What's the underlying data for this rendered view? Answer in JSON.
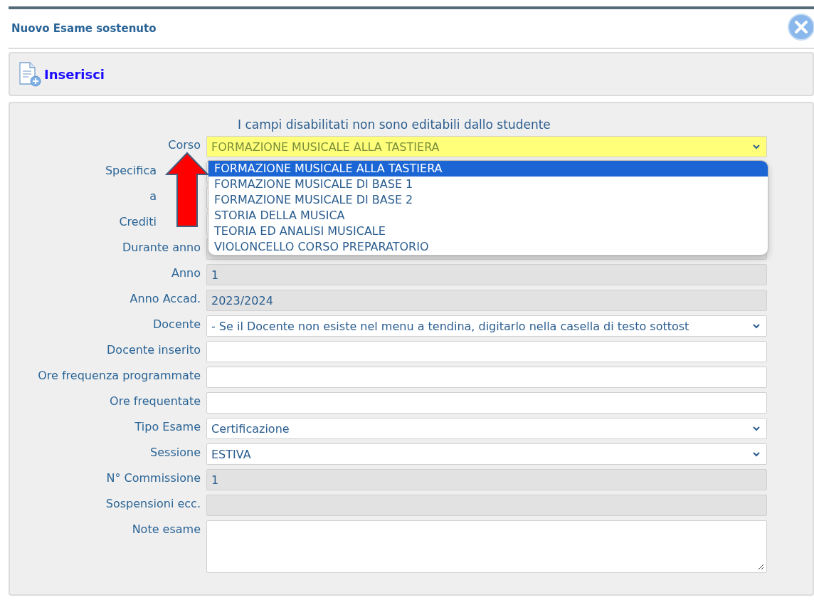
{
  "window": {
    "title": "Nuovo Esame sostenuto"
  },
  "toolbar": {
    "label": "Inserisci"
  },
  "notice": "I campi disabilitati non sono editabili dallo studente",
  "fields": [
    {
      "label": "Corso",
      "kind": "select",
      "value": "FORMAZIONE MUSICALE ALLA TASTIERA",
      "disabled": false,
      "highlighted": true
    },
    {
      "label": "Specifica",
      "kind": "text",
      "disabled": false,
      "highlighted": false
    },
    {
      "label": "a",
      "kind": "text",
      "disabled": false,
      "highlighted": false
    },
    {
      "label": "Crediti",
      "kind": "text",
      "disabled": false,
      "highlighted": false
    },
    {
      "label": "Durante anno",
      "kind": "text",
      "disabled": true,
      "highlighted": false
    },
    {
      "label": "Anno",
      "kind": "text",
      "value": "1",
      "disabled": true,
      "highlighted": false
    },
    {
      "label": "Anno Accad.",
      "kind": "text",
      "value": "2023/2024",
      "disabled": true,
      "highlighted": false
    },
    {
      "label": "Docente",
      "kind": "select",
      "value": "- Se il Docente non esiste nel menu a tendina, digitarlo nella casella di testo sottost",
      "disabled": false,
      "highlighted": false
    },
    {
      "label": "Docente inserito",
      "kind": "text",
      "disabled": false,
      "highlighted": false
    },
    {
      "label": "Ore frequenza programmate",
      "kind": "text",
      "disabled": false,
      "highlighted": false
    },
    {
      "label": "Ore frequentate",
      "kind": "text",
      "disabled": false,
      "highlighted": false
    },
    {
      "label": "Tipo Esame",
      "kind": "select",
      "value": "Certificazione",
      "disabled": false,
      "highlighted": false
    },
    {
      "label": "Sessione",
      "kind": "select",
      "value": "ESTIVA",
      "disabled": false,
      "highlighted": false
    },
    {
      "label": "N° Commissione",
      "kind": "text",
      "value": "1",
      "disabled": true,
      "highlighted": false
    },
    {
      "label": "Sospensioni ecc.",
      "kind": "text",
      "disabled": true,
      "highlighted": false
    },
    {
      "label": "Note esame",
      "kind": "textarea",
      "disabled": false,
      "highlighted": false
    }
  ],
  "dropdown": {
    "options": [
      {
        "label": "FORMAZIONE MUSICALE ALLA TASTIERA",
        "selected": true
      },
      {
        "label": "FORMAZIONE MUSICALE DI BASE 1",
        "selected": false
      },
      {
        "label": "FORMAZIONE MUSICALE DI BASE 2",
        "selected": false
      },
      {
        "label": "STORIA DELLA MUSICA",
        "selected": false
      },
      {
        "label": "TEORIA ED ANALISI MUSICALE",
        "selected": false
      },
      {
        "label": "VIOLONCELLO CORSO PREPARATORIO",
        "selected": false
      }
    ]
  }
}
